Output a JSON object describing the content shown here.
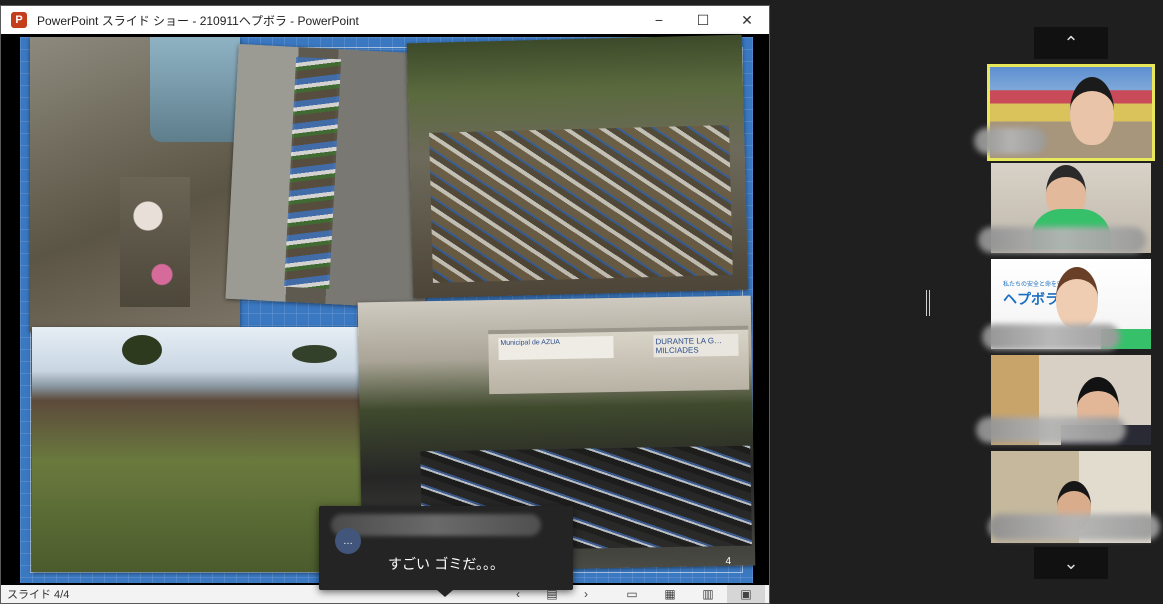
{
  "window": {
    "title": "PowerPoint スライド ショー  -  210911ヘプボラ - PowerPoint",
    "app_icon_letter": "P",
    "controls": {
      "minimize": "−",
      "maximize": "☐",
      "close": "✕"
    }
  },
  "slide": {
    "number": "4"
  },
  "statusbar": {
    "slide_counter": "スライド 4/4",
    "prev": "‹",
    "notes": "▤",
    "next": "›",
    "views": [
      "▭",
      "▦",
      "▥",
      "▣"
    ]
  },
  "chat_toast": {
    "avatar_initials": "…",
    "message": "すごい ゴミだ。。。"
  },
  "participants": {
    "scroll_up": "⌃",
    "scroll_down": "⌄",
    "tile3_logo": "ヘプボラ",
    "tile3_logo_sub": "私たちの安全と命を守る"
  },
  "photo_signs": {
    "sign_left": "Municipal de AZUA",
    "sign_right": "DURANTE LA G… MILCIADES"
  },
  "colors": {
    "active_speaker_border": "#e8e85b",
    "slide_background": "#3a78c2",
    "toast_background": "#242424"
  }
}
